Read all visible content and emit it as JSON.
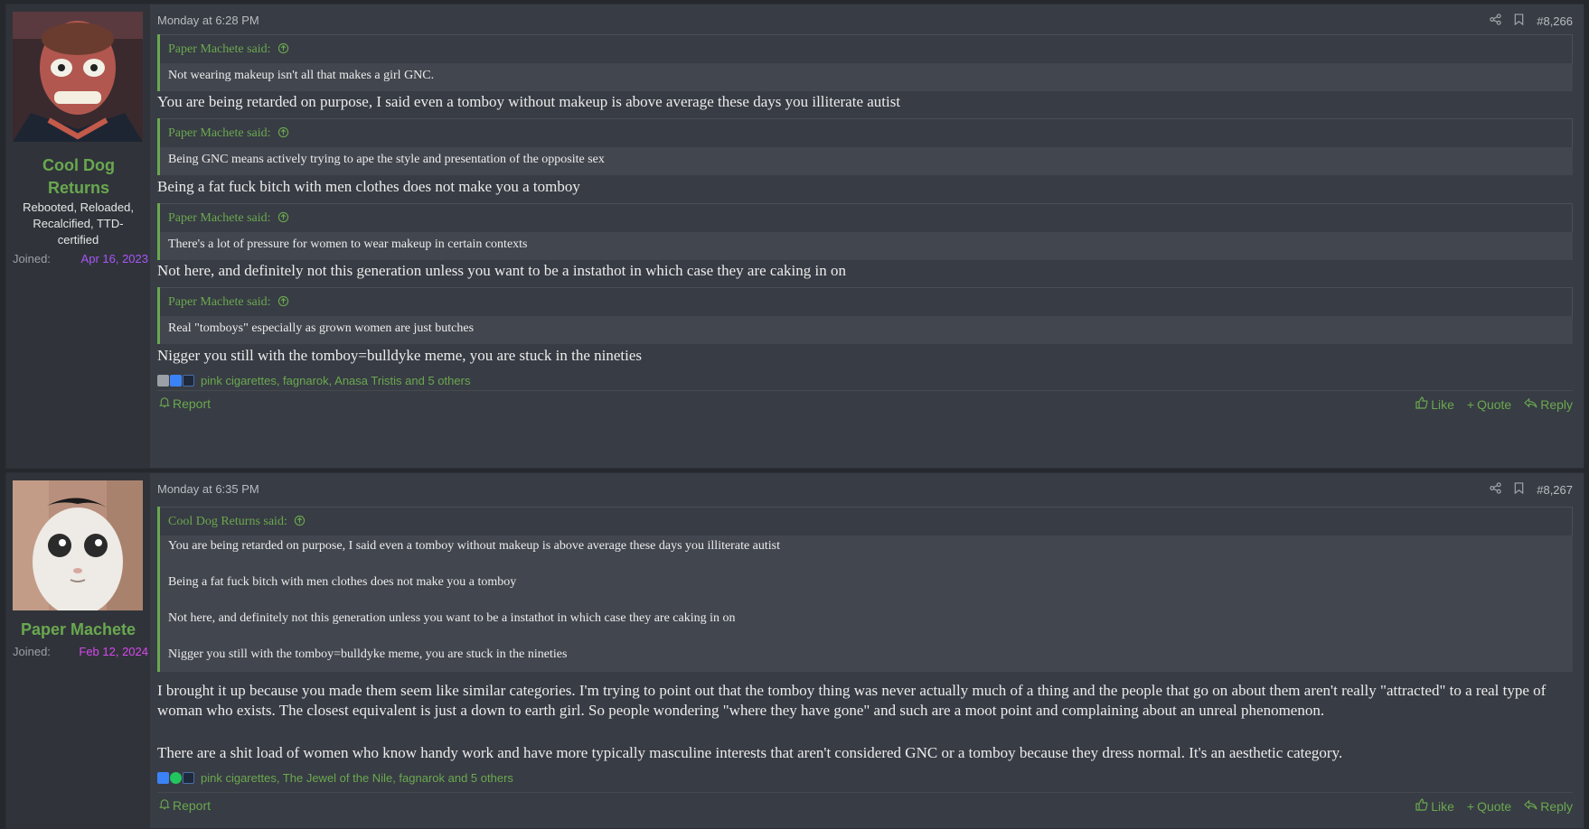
{
  "posts": [
    {
      "username": "Cool Dog Returns",
      "user_title": "Rebooted, Reloaded, Recalcified, TTD-certified",
      "joined_label": "Joined:",
      "joined_date": "Apr 16, 2023",
      "joined_color": "#a855f7",
      "date": "Monday at 6:28 PM",
      "post_number": "#8,266",
      "quotes": [
        {
          "author": "Paper Machete said:",
          "lines": [
            "Not wearing makeup isn't all that makes a girl GNC."
          ]
        },
        {
          "author": "Paper Machete said:",
          "lines": [
            "Being GNC means actively trying to ape the style and presentation of the opposite sex"
          ]
        },
        {
          "author": "Paper Machete said:",
          "lines": [
            "There's a lot of pressure for women to wear makeup in certain contexts"
          ]
        },
        {
          "author": "Paper Machete said:",
          "lines": [
            "Real \"tomboys\" especially as grown women are just butches"
          ]
        }
      ],
      "replies": [
        "You are being retarded on purpose, I said even a tomboy without makeup is above average these days you illiterate autist",
        "Being a fat fuck bitch with men clothes does not make you a tomboy",
        "Not here, and definitely not this generation unless you want to be a instathot in which case they are caking in on",
        "Nigger you still with the tomboy=bulldyke meme, you are stuck in the nineties"
      ],
      "reactions": "pink cigarettes, fagnarok, Anasa Tristis and 5 others",
      "report": "Report",
      "like": "Like",
      "quote": "Quote",
      "reply": "Reply"
    },
    {
      "username": "Paper Machete",
      "joined_label": "Joined:",
      "joined_date": "Feb 12, 2024",
      "joined_color": "#d946ef",
      "date": "Monday at 6:35 PM",
      "post_number": "#8,267",
      "quote": {
        "author": "Cool Dog Returns said:",
        "lines": [
          "You are being retarded on purpose, I said even a tomboy without makeup is above average these days you illiterate autist",
          "Being a fat fuck bitch with men clothes does not make you a tomboy",
          "Not here, and definitely not this generation unless you want to be a instathot in which case they are caking in on",
          "Nigger you still with the tomboy=bulldyke meme, you are stuck in the nineties"
        ]
      },
      "body_paragraphs": [
        "I brought it up because you made them seem like similar categories. I'm trying to point out that the tomboy thing was never actually much of a thing and the people that go on about them aren't really \"attracted\" to a real type of woman who exists. The closest equivalent is just a down to earth girl. So people wondering \"where they have gone\" and such are a moot point and complaining about an unreal phenomenon.",
        "There are a shit load of women who know handy work and have more typically masculine interests that aren't considered GNC or a tomboy because they dress normal. It's an aesthetic category."
      ],
      "reactions": "pink cigarettes, The Jewel of the Nile, fagnarok and 5 others",
      "report": "Report",
      "like": "Like",
      "quote_label": "Quote",
      "reply": "Reply"
    }
  ],
  "colors": {
    "accent": "#6aa84f",
    "background": "#25282d",
    "post_bg": "#383c44",
    "sidebar_bg": "#30343a"
  }
}
